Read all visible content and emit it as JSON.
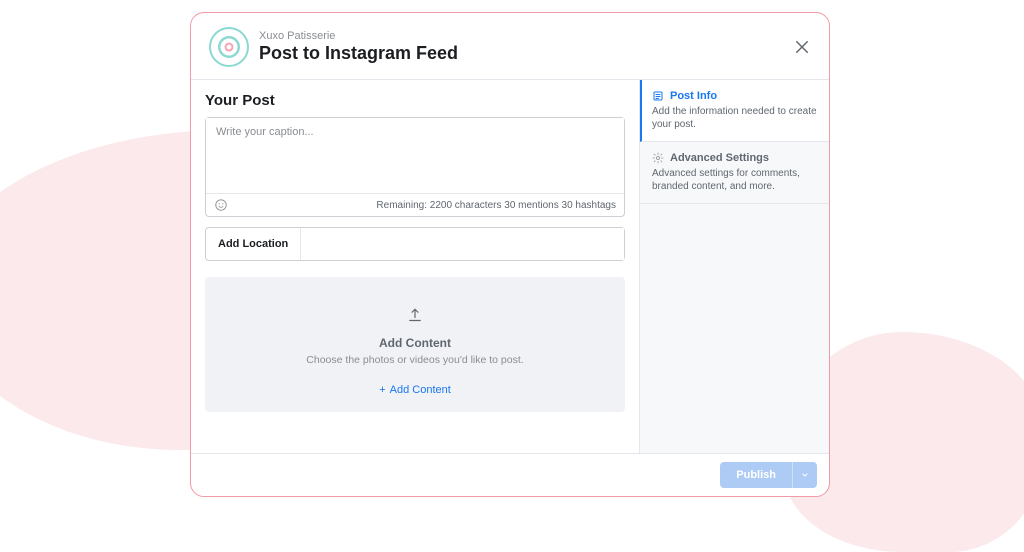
{
  "header": {
    "account_name": "Xuxo Patisserie",
    "title": "Post to Instagram Feed"
  },
  "main": {
    "section_title": "Your Post",
    "caption_placeholder": "Write your caption...",
    "caption_value": "",
    "remaining_text": "Remaining: 2200 characters 30 mentions 30 hashtags",
    "location_label": "Add Location",
    "location_value": "",
    "content_drop": {
      "title": "Add Content",
      "subtitle": "Choose the photos or videos you'd like to post.",
      "link_text": "Add Content"
    }
  },
  "sidebar": {
    "items": [
      {
        "title": "Post Info",
        "desc": "Add the information needed to create your post.",
        "active": true
      },
      {
        "title": "Advanced Settings",
        "desc": "Advanced settings for comments, branded content, and more.",
        "active": false
      }
    ]
  },
  "footer": {
    "publish_label": "Publish"
  }
}
